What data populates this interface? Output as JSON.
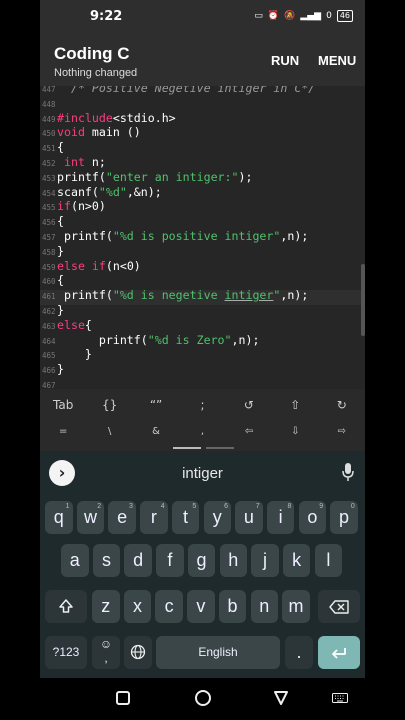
{
  "status": {
    "time": "9:22",
    "battery": "46",
    "net": "0"
  },
  "appbar": {
    "title": "Coding C",
    "subtitle": "Nothing changed",
    "run": "RUN",
    "menu": "MENU"
  },
  "editor": {
    "lines": [
      {
        "n": "447",
        "html": "<span class='cm'>  /* Positive Negetive intiger in C*/</span>"
      },
      {
        "n": "448",
        "html": ""
      },
      {
        "n": "449",
        "html": "<span class='kw'>#include</span><span class='tx'>&lt;stdio.h&gt;</span>"
      },
      {
        "n": "450",
        "html": "<span class='kw'>void</span><span class='tx'> main ()</span>"
      },
      {
        "n": "451",
        "html": "<span class='tx'>{</span>"
      },
      {
        "n": "452",
        "html": "<span class='kw'> int</span><span class='tx'> n;</span>"
      },
      {
        "n": "453",
        "html": "<span class='tx'>printf(</span><span class='str'>\"enter an intiger:\"</span><span class='tx'>);</span>"
      },
      {
        "n": "454",
        "html": "<span class='tx'>scanf(</span><span class='str'>\"%d\"</span><span class='tx'>,&amp;n);</span>"
      },
      {
        "n": "455",
        "html": "<span class='kw'>if</span><span class='tx'>(n&gt;0)</span>"
      },
      {
        "n": "456",
        "html": "<span class='tx'>{</span>"
      },
      {
        "n": "457",
        "html": "<span class='tx'> printf(</span><span class='str'>\"%d is positive intiger\"</span><span class='tx'>,n);</span>"
      },
      {
        "n": "458",
        "html": "<span class='tx'>}</span>"
      },
      {
        "n": "459",
        "html": "<span class='kw'>else if</span><span class='tx'>(n&lt;0)</span>"
      },
      {
        "n": "460",
        "html": "<span class='tx'>{</span>"
      },
      {
        "n": "461",
        "html": "<span class='tx'> printf(</span><span class='str'>\"%d is negetive <span class='ul'>intiger</span>\"</span><span class='tx'>,n);</span>"
      },
      {
        "n": "462",
        "html": "<span class='tx'>}</span>"
      },
      {
        "n": "463",
        "html": "<span class='kw'>else</span><span class='tx'>{</span>"
      },
      {
        "n": "464",
        "html": "<span class='tx'>      printf(</span><span class='str'>\"%d is Zero\"</span><span class='tx'>,n);</span>"
      },
      {
        "n": "465",
        "html": "<span class='tx'>    }</span>"
      },
      {
        "n": "466",
        "html": "<span class='tx'>}</span>"
      },
      {
        "n": "467",
        "html": ""
      }
    ]
  },
  "symbols": {
    "row1": [
      "Tab",
      "{}",
      "“”",
      ";",
      "↺",
      "⇧",
      "↻"
    ],
    "row2": [
      "=",
      "\\",
      "&",
      ",",
      "⇦",
      "⇩",
      "⇨"
    ]
  },
  "keyboard": {
    "suggestion": "intiger",
    "row1": [
      [
        "q",
        "1"
      ],
      [
        "w",
        "2"
      ],
      [
        "e",
        "3"
      ],
      [
        "r",
        "4"
      ],
      [
        "t",
        "5"
      ],
      [
        "y",
        "6"
      ],
      [
        "u",
        "7"
      ],
      [
        "i",
        "8"
      ],
      [
        "o",
        "9"
      ],
      [
        "p",
        "0"
      ]
    ],
    "row2": [
      "a",
      "s",
      "d",
      "f",
      "g",
      "h",
      "j",
      "k",
      "l"
    ],
    "row3": [
      "z",
      "x",
      "c",
      "v",
      "b",
      "n",
      "m"
    ],
    "num_label": "?123",
    "space_label": "English",
    "period": ".",
    "comma": ","
  },
  "colors": {
    "keyword": "#ff3b83",
    "string": "#4fc26b",
    "comment": "#9a9a9a",
    "enter": "#7fb7b4"
  }
}
